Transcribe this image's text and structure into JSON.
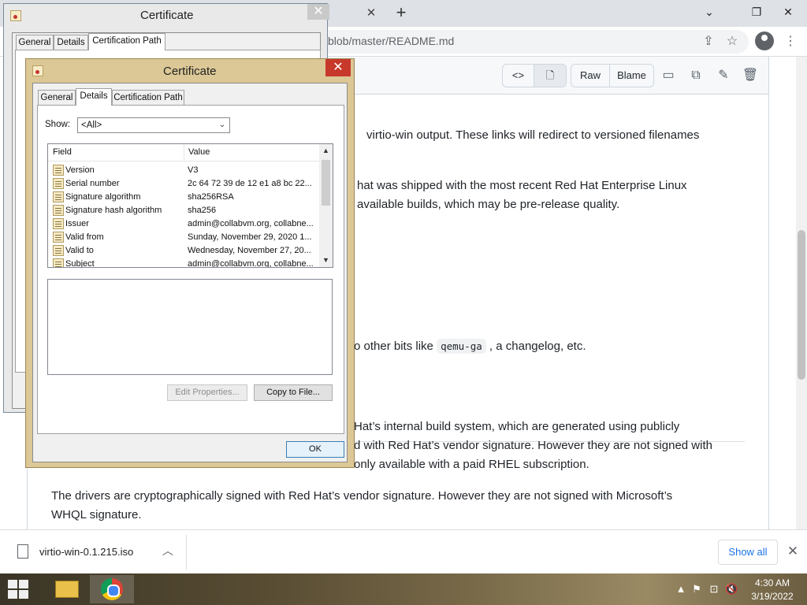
{
  "browser": {
    "tab_close": "✕",
    "new_tab": "+",
    "url_visible": "blob/master/README.md",
    "file_header": {
      "raw_label": "Raw",
      "blame_label": "Blame"
    },
    "article_lines": [
      "virtio-win output. These links will redirect to versioned filenames",
      "hat was shipped with the most recent Red Hat Enterprise Linux",
      "available builds, which may be pre-release quality.",
      "o other bits like",
      "qemu-ga",
      ", a changelog, etc.",
      "Hat’s internal build system, which are generated using publicly",
      "d with Red Hat’s vendor signature. However they are not signed with",
      "only available with a paid RHEL subscription.",
      "The drivers are cryptographically signed with Red Hat’s vendor signature. However they are not signed with Microsoft’s",
      "WHQL signature."
    ],
    "downloads": {
      "file_name": "virtio-win-0.1.215.iso",
      "show_all": "Show all"
    }
  },
  "back_dialog": {
    "title": "Certificate",
    "tabs": [
      "General",
      "Details",
      "Certification Path"
    ]
  },
  "dialog": {
    "title": "Certificate",
    "close": "✕",
    "tabs": [
      "General",
      "Details",
      "Certification Path"
    ],
    "show_label": "Show:",
    "show_value": "<All>",
    "columns": [
      "Field",
      "Value"
    ],
    "rows": [
      {
        "field": "Version",
        "value": "V3"
      },
      {
        "field": "Serial number",
        "value": "2c 64 72 39 de 12 e1 a8 bc 22..."
      },
      {
        "field": "Signature algorithm",
        "value": "sha256RSA"
      },
      {
        "field": "Signature hash algorithm",
        "value": "sha256"
      },
      {
        "field": "Issuer",
        "value": "admin@collabvm.org, collabne..."
      },
      {
        "field": "Valid from",
        "value": "Sunday, November 29, 2020 1..."
      },
      {
        "field": "Valid to",
        "value": "Wednesday, November 27, 20..."
      },
      {
        "field": "Subject",
        "value": "admin@collabvm.org, collabne..."
      }
    ],
    "edit_properties": "Edit Properties...",
    "copy_to_file": "Copy to File...",
    "ok": "OK"
  },
  "taskbar": {
    "time": "4:30 AM",
    "date": "3/19/2022"
  },
  "colors": {
    "dialog_frame": "#dcc896",
    "close_red": "#c7392b",
    "link_blue": "#1a73e8"
  }
}
